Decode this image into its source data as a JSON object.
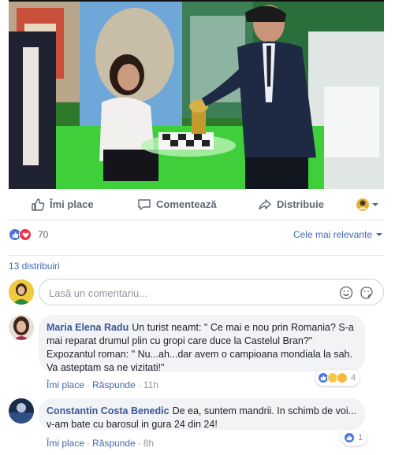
{
  "actions": {
    "like_label": "Îmi place",
    "comment_label": "Comentează",
    "share_label": "Distribuie"
  },
  "reactions": {
    "count": "70",
    "sort_label": "Cele mai relevante"
  },
  "shares_label": "13 distribuiri",
  "composer": {
    "placeholder": "Lasă un comentariu..."
  },
  "comments": [
    {
      "author": "Maria Elena Radu",
      "text": "Un turist neamt: \" Ce mai e nou prin Romania? S-a mai reparat drumul plin cu gropi care duce la Castelul Bran?\" Expozantul roman: \" Nu...ah...dar avem o campioana mondiala la sah. Va asteptam sa ne vizitati!\"",
      "like_label": "Îmi place",
      "reply_label": "Răspunde",
      "time": "11h",
      "reaction_count": "4"
    },
    {
      "author": "Constantin Costa Benedic",
      "text": "De ea, suntem mandrii. In schimb de voi... v-am bate cu barosul in gura 24 din 24!",
      "like_label": "Îmi place",
      "reply_label": "Răspunde",
      "time": "8h",
      "reaction_count": "1"
    }
  ],
  "colors": {
    "link": "#4267b2",
    "author": "#385898",
    "like_blue": "#4a76d9",
    "love_red": "#f0334c",
    "bubble_bg": "#f2f3f5"
  }
}
